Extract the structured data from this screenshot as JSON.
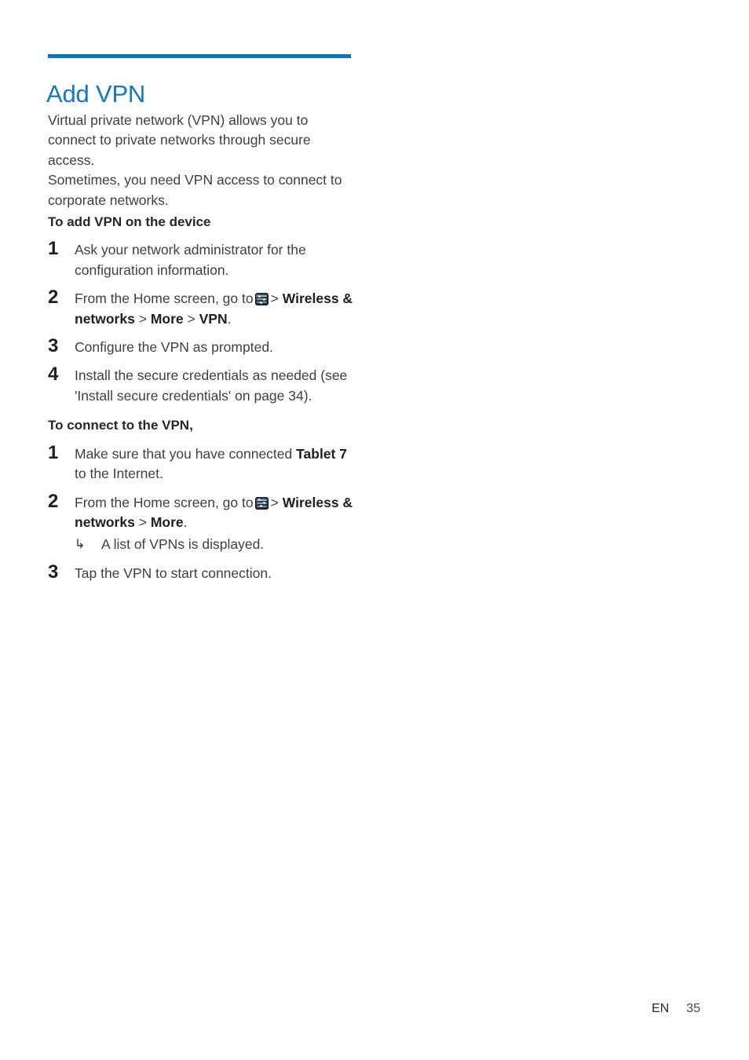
{
  "document": {
    "title": "Add VPN",
    "accent_color": "#1179bf",
    "rule_color": "#0b76bf"
  },
  "intro": {
    "paragraph_1": "Virtual private network (VPN) allows you to connect to private networks through secure access.",
    "paragraph_2": "Sometimes, you need VPN access to connect to corporate networks."
  },
  "sections": [
    {
      "heading": "To add VPN on the device",
      "steps": [
        {
          "number": "1",
          "text": "Ask your network administrator for the configuration information."
        },
        {
          "number": "2",
          "lead": "From the Home screen, go to",
          "icon": "android-settings-icon",
          "sep1": ">",
          "path_1": "Wireless & networks",
          "sep2": ">",
          "path_2": "More",
          "sep3": ">",
          "path_3": "VPN",
          "trail": "."
        },
        {
          "number": "3",
          "text": "Configure the VPN as prompted."
        },
        {
          "number": "4",
          "text": "Install the secure credentials as needed (see 'Install secure credentials' on page 34)."
        }
      ]
    },
    {
      "heading": "To connect to the VPN,",
      "steps": [
        {
          "number": "1",
          "lead": "Make sure that you have connected",
          "bold": "Tablet 7",
          "trail": "to the Internet."
        },
        {
          "number": "2",
          "lead": "From the Home screen, go to",
          "icon": "android-settings-icon",
          "sep1": ">",
          "path_1": "Wireless & networks",
          "sep2": ">",
          "path_2": "More",
          "trail": ".",
          "result_bullet": "↳",
          "result": "A list of VPNs is displayed."
        },
        {
          "number": "3",
          "text": "Tap the VPN to start connection."
        }
      ]
    }
  ],
  "footer": {
    "language": "EN",
    "page_number": "35"
  }
}
